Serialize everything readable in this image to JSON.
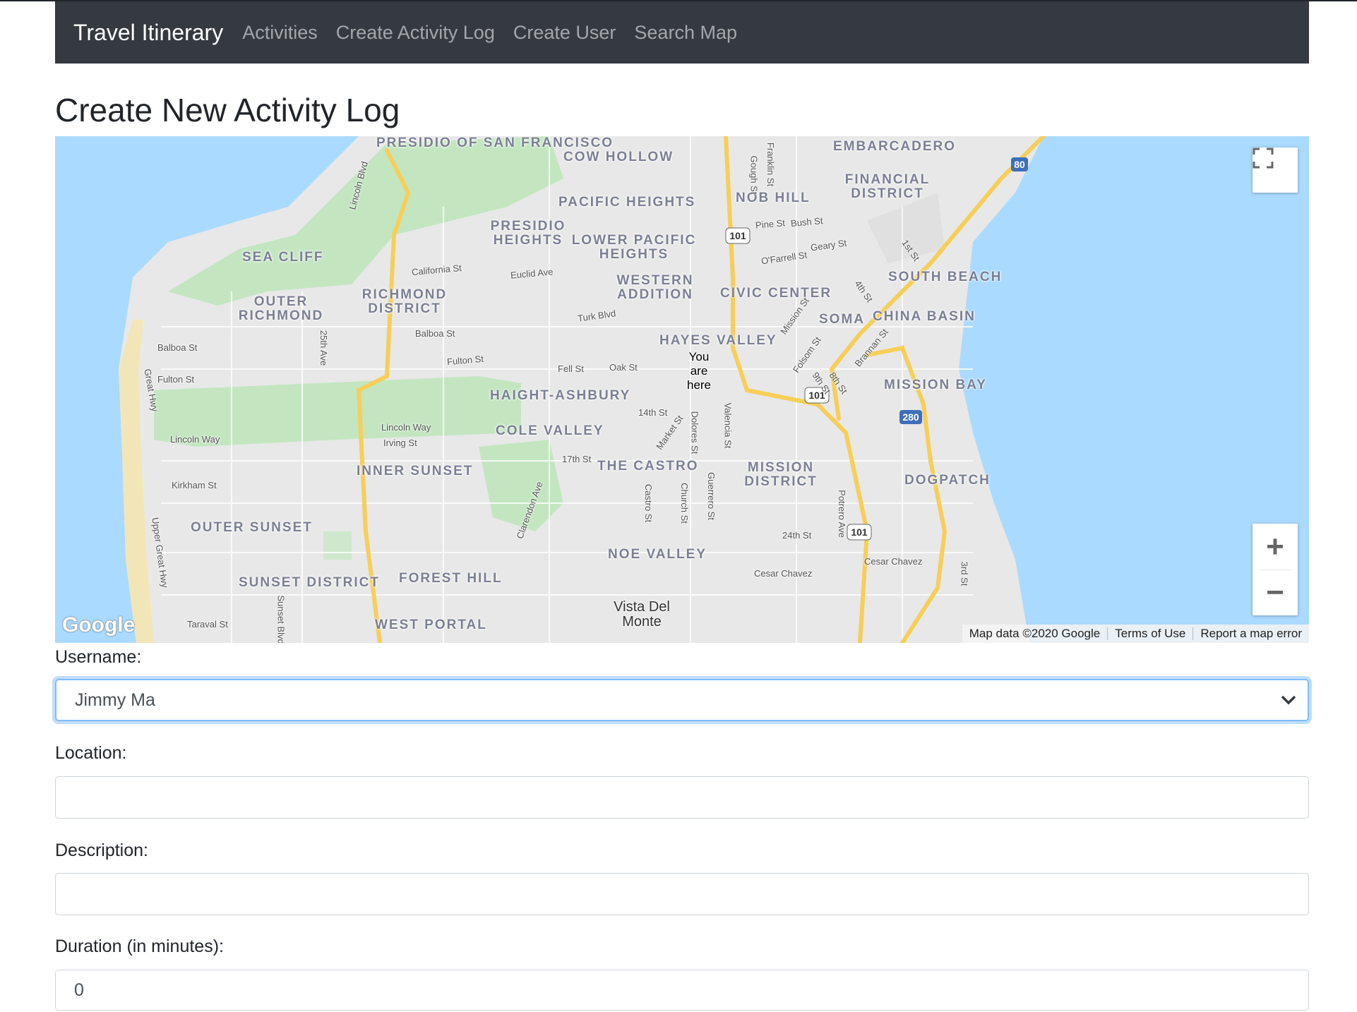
{
  "navbar": {
    "brand": "Travel Itinerary",
    "links": [
      "Activities",
      "Create Activity Log",
      "Create User",
      "Search Map"
    ]
  },
  "page": {
    "title": "Create New Activity Log"
  },
  "map": {
    "neighborhoods": [
      "PRESIDIO OF SAN FRANCISCO",
      "COW HOLLOW",
      "EMBARCADERO",
      "FINANCIAL DISTRICT",
      "PACIFIC HEIGHTS",
      "NOB HILL",
      "PRESIDIO HEIGHTS",
      "LOWER PACIFIC HEIGHTS",
      "SEA CLIFF",
      "OUTER RICHMOND",
      "RICHMOND DISTRICT",
      "WESTERN ADDITION",
      "CIVIC CENTER",
      "SOUTH BEACH",
      "SOMA",
      "CHINA BASIN",
      "HAYES VALLEY",
      "MISSION BAY",
      "HAIGHT-ASHBURY",
      "COLE VALLEY",
      "INNER SUNSET",
      "THE CASTRO",
      "MISSION DISTRICT",
      "DOGPATCH",
      "OUTER SUNSET",
      "NOE VALLEY",
      "SUNSET DISTRICT",
      "FOREST HILL",
      "WEST PORTAL"
    ],
    "streets": [
      "Lincoln Blvd",
      "California St",
      "Euclid Ave",
      "Balboa St",
      "Fulton St",
      "Turk Blvd",
      "Fell St",
      "Oak St",
      "Lincoln Way",
      "Irving St",
      "Kirkham St",
      "Taraval St",
      "Great Hwy",
      "Upper Great Hwy",
      "25th Ave",
      "Sunset Blvd",
      "14th St",
      "17th St",
      "Market St",
      "Dolores St",
      "Valencia St",
      "Castro St",
      "Church St",
      "Guerrero St",
      "Clarendon Ave",
      "24th St",
      "Cesar Chavez",
      "Potrero Ave",
      "3rd St",
      "Pine St",
      "Bush St",
      "Geary St",
      "O'Farrell St",
      "Mission St",
      "Folsom St",
      "Brannan St",
      "4th St",
      "1st St",
      "9th St",
      "8th St",
      "Franklin St",
      "Gough St"
    ],
    "highway_shields": [
      "101",
      "80",
      "280"
    ],
    "you_are_here": "You are here",
    "place": "Vista Del Monte",
    "logo": "Google",
    "attribution": [
      "Map data ©2020 Google",
      "Terms of Use",
      "Report a map error"
    ],
    "controls": {
      "zoom_in": "+",
      "zoom_out": "−"
    }
  },
  "form": {
    "username_label": "Username:",
    "username_value": "Jimmy Ma",
    "location_label": "Location:",
    "location_value": "",
    "description_label": "Description:",
    "description_value": "",
    "duration_label": "Duration (in minutes):",
    "duration_value": "0"
  },
  "colors": {
    "navbar": "#343a40",
    "water": "#aadaff",
    "park": "#c3e6c1",
    "land": "#e8e8e8",
    "highway": "#f7ce58",
    "focus_ring": "#80bdff"
  }
}
